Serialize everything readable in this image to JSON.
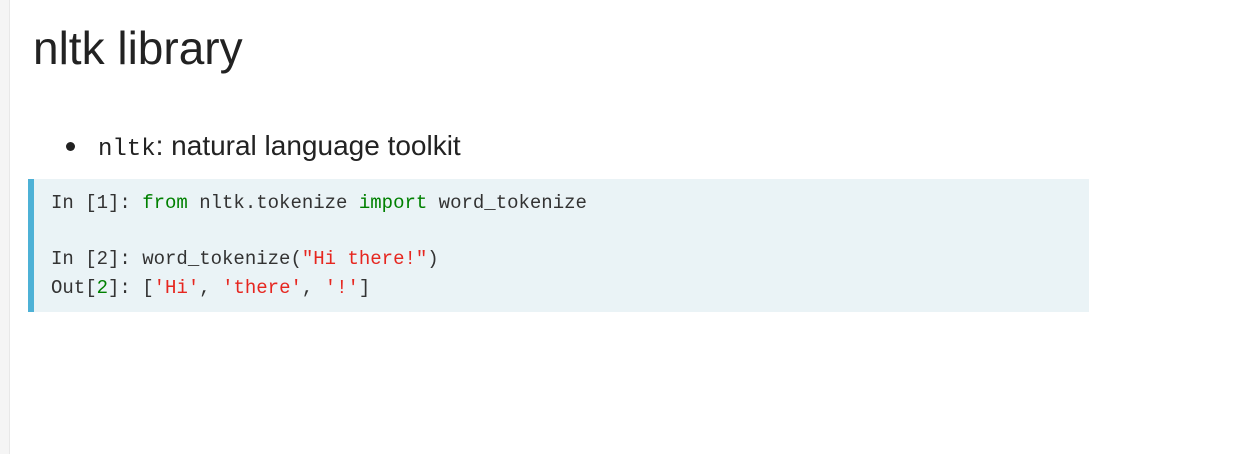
{
  "page": {
    "title": "nltk library"
  },
  "bullets": [
    {
      "code": "nltk",
      "text": ": natural language toolkit"
    }
  ],
  "code_panel": {
    "cell1": {
      "prompt": "In [1]: ",
      "kw_from": "from",
      "module": " nltk.tokenize ",
      "kw_import": "import",
      "name": " word_tokenize"
    },
    "cell2": {
      "prompt": "In [2]: ",
      "call_open": "word_tokenize(",
      "arg": "\"Hi there!\"",
      "call_close": ")"
    },
    "out2": {
      "prompt_prefix": "Out[",
      "prompt_num": "2",
      "prompt_suffix": "]: ",
      "open": "[",
      "item1": "'Hi'",
      "sep1": ", ",
      "item2": "'there'",
      "sep2": ", ",
      "item3": "'!'",
      "close": "]"
    }
  },
  "colors": {
    "keyword": "#008000",
    "string": "#e6261f",
    "panel_background": "#eaf3f6",
    "panel_border": "#4eb1d6"
  }
}
